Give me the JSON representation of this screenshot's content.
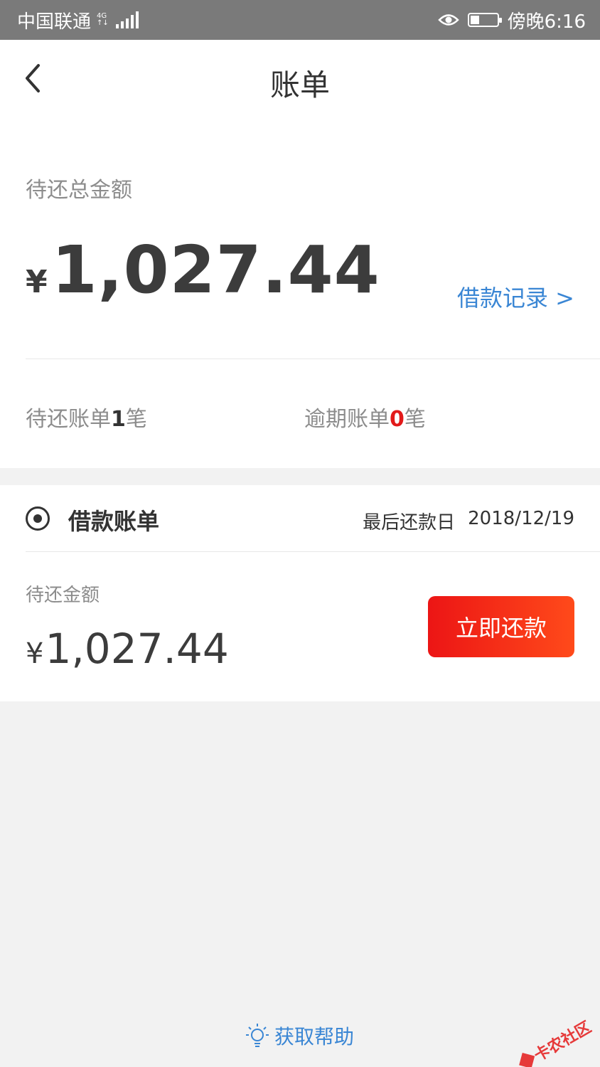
{
  "status_bar": {
    "carrier": "中国联通",
    "network_top": "4G",
    "network_bottom": "↑↓",
    "time": "傍晚6:16",
    "icons": [
      "signal-icon",
      "eye-icon",
      "battery-icon"
    ]
  },
  "nav": {
    "title": "账单",
    "back_icon": "chevron-left-icon"
  },
  "summary": {
    "label": "待还总金额",
    "currency": "¥",
    "amount": "1,027.44",
    "loan_records_link": "借款记录 >",
    "pending_prefix": "待还账单",
    "pending_count": "1",
    "pending_suffix": "笔",
    "overdue_prefix": "逾期账单",
    "overdue_count": "0",
    "overdue_suffix": "笔"
  },
  "bill": {
    "icon": "target-circle-icon",
    "title": "借款账单",
    "due_label": "最后还款日",
    "due_date": "2018/12/19",
    "amount_label": "待还金额",
    "currency": "¥",
    "amount": "1,027.44",
    "pay_button": "立即还款"
  },
  "help": {
    "icon": "lightbulb-icon",
    "label": "获取帮助"
  },
  "watermark": {
    "text": "卡农社区"
  },
  "colors": {
    "accent_blue": "#3a86d4",
    "alert_red": "#e21a1a",
    "button_gradient_start": "#ec1515",
    "button_gradient_end": "#ff4a1a"
  }
}
